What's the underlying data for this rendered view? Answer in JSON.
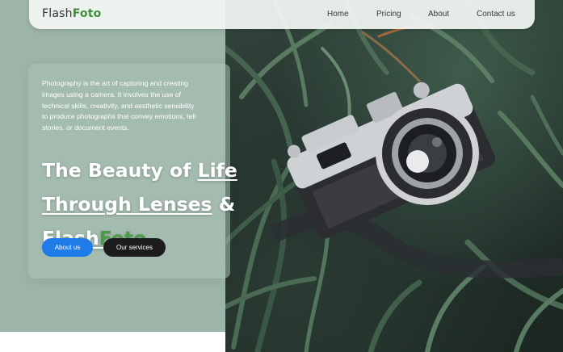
{
  "brand": {
    "name_part1": "Flash",
    "name_part2": "Foto",
    "accent_color": "#3f8f3a"
  },
  "nav": {
    "items": [
      {
        "label": "Home"
      },
      {
        "label": "Pricing"
      },
      {
        "label": "About"
      },
      {
        "label": "Contact us"
      }
    ]
  },
  "hero": {
    "description": "Photography is the art of capturing and creating images using a camera. It involves the use of technical skills, creativity, and aesthetic sensibility to produce photographs that convey emotions, tell stories, or document events.",
    "title_prefix": "The Beauty of ",
    "title_link1": "Life Through Lenses",
    "title_amp": " & ",
    "title_brand1": "Flash",
    "title_brand2": "Foto",
    "primary_button": "About us",
    "secondary_button": "Our services"
  },
  "colors": {
    "panel": "#9db5a8",
    "primary_button": "#1e7be8",
    "secondary_button": "#1c1c1c"
  },
  "image": {
    "subject": "vintage camera lying in grass",
    "icon": "camera-photo"
  }
}
